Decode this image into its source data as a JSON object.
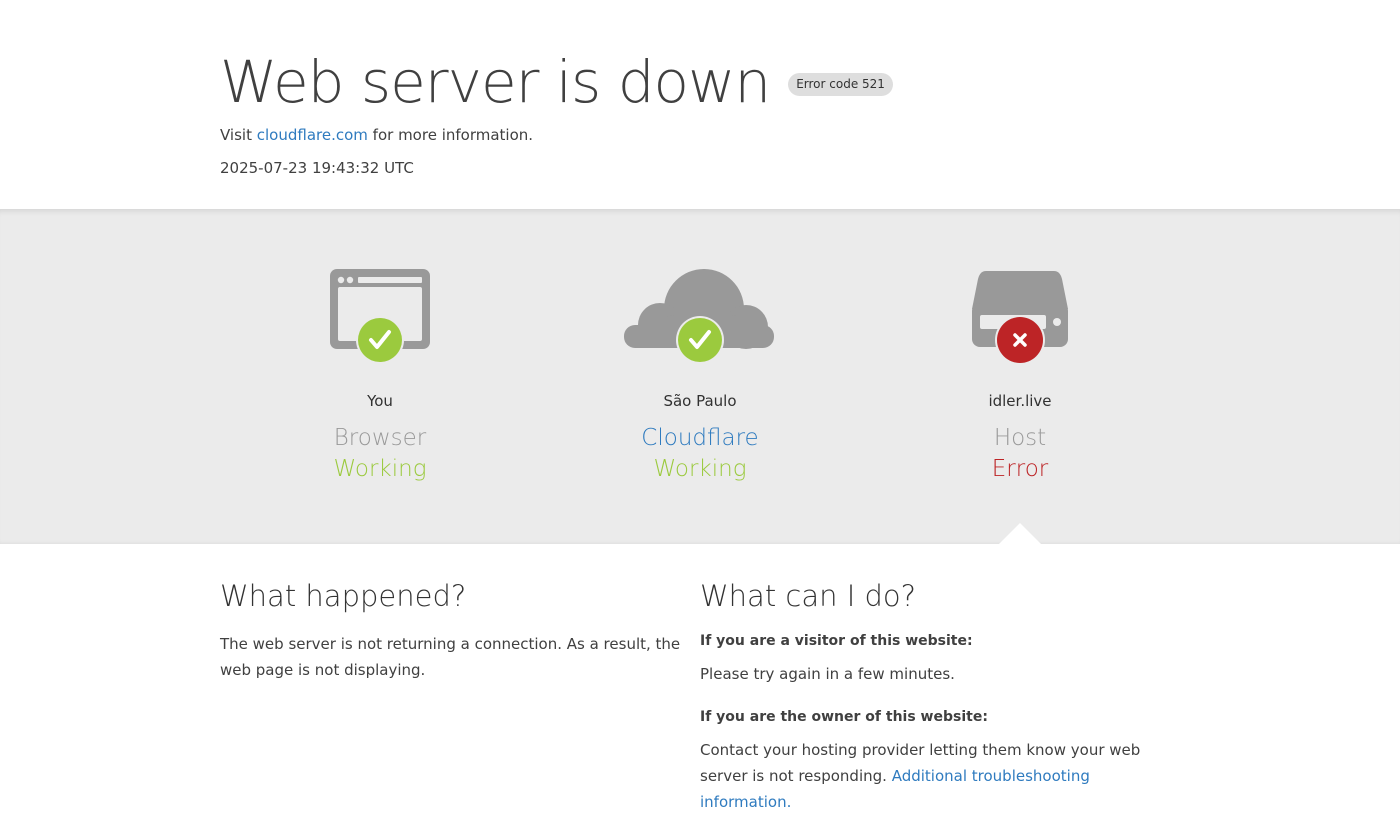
{
  "header": {
    "title": "Web server is down",
    "error_code": "Error code 521",
    "visit_prefix": "Visit",
    "visit_link": "cloudflare.com",
    "visit_suffix": "for more information.",
    "timestamp": "2025-07-23 19:43:32 UTC"
  },
  "status": [
    {
      "location": "You",
      "name": "Browser",
      "state": "Working",
      "icon": "browser-icon",
      "badge": "check-icon"
    },
    {
      "location": "São Paulo",
      "name": "Cloudflare",
      "state": "Working",
      "icon": "cloud-icon",
      "badge": "check-icon"
    },
    {
      "location": "idler.live",
      "name": "Host",
      "state": "Error",
      "icon": "server-icon",
      "badge": "x-icon"
    }
  ],
  "what_happened": {
    "heading": "What happened?",
    "body": "The web server is not returning a connection. As a result, the web page is not displaying."
  },
  "what_can_i_do": {
    "heading": "What can I do?",
    "visitor_heading": "If you are a visitor of this website:",
    "visitor_body": "Please try again in a few minutes.",
    "owner_heading": "If you are the owner of this website:",
    "owner_body": "Contact your hosting provider letting them know your web server is not responding.",
    "owner_link": "Additional troubleshooting information."
  },
  "colors": {
    "ok": "#9bca3e",
    "error": "#bd2426",
    "link": "#2f7bbf",
    "icon_gray": "#999999",
    "band_bg": "#ebebeb"
  }
}
